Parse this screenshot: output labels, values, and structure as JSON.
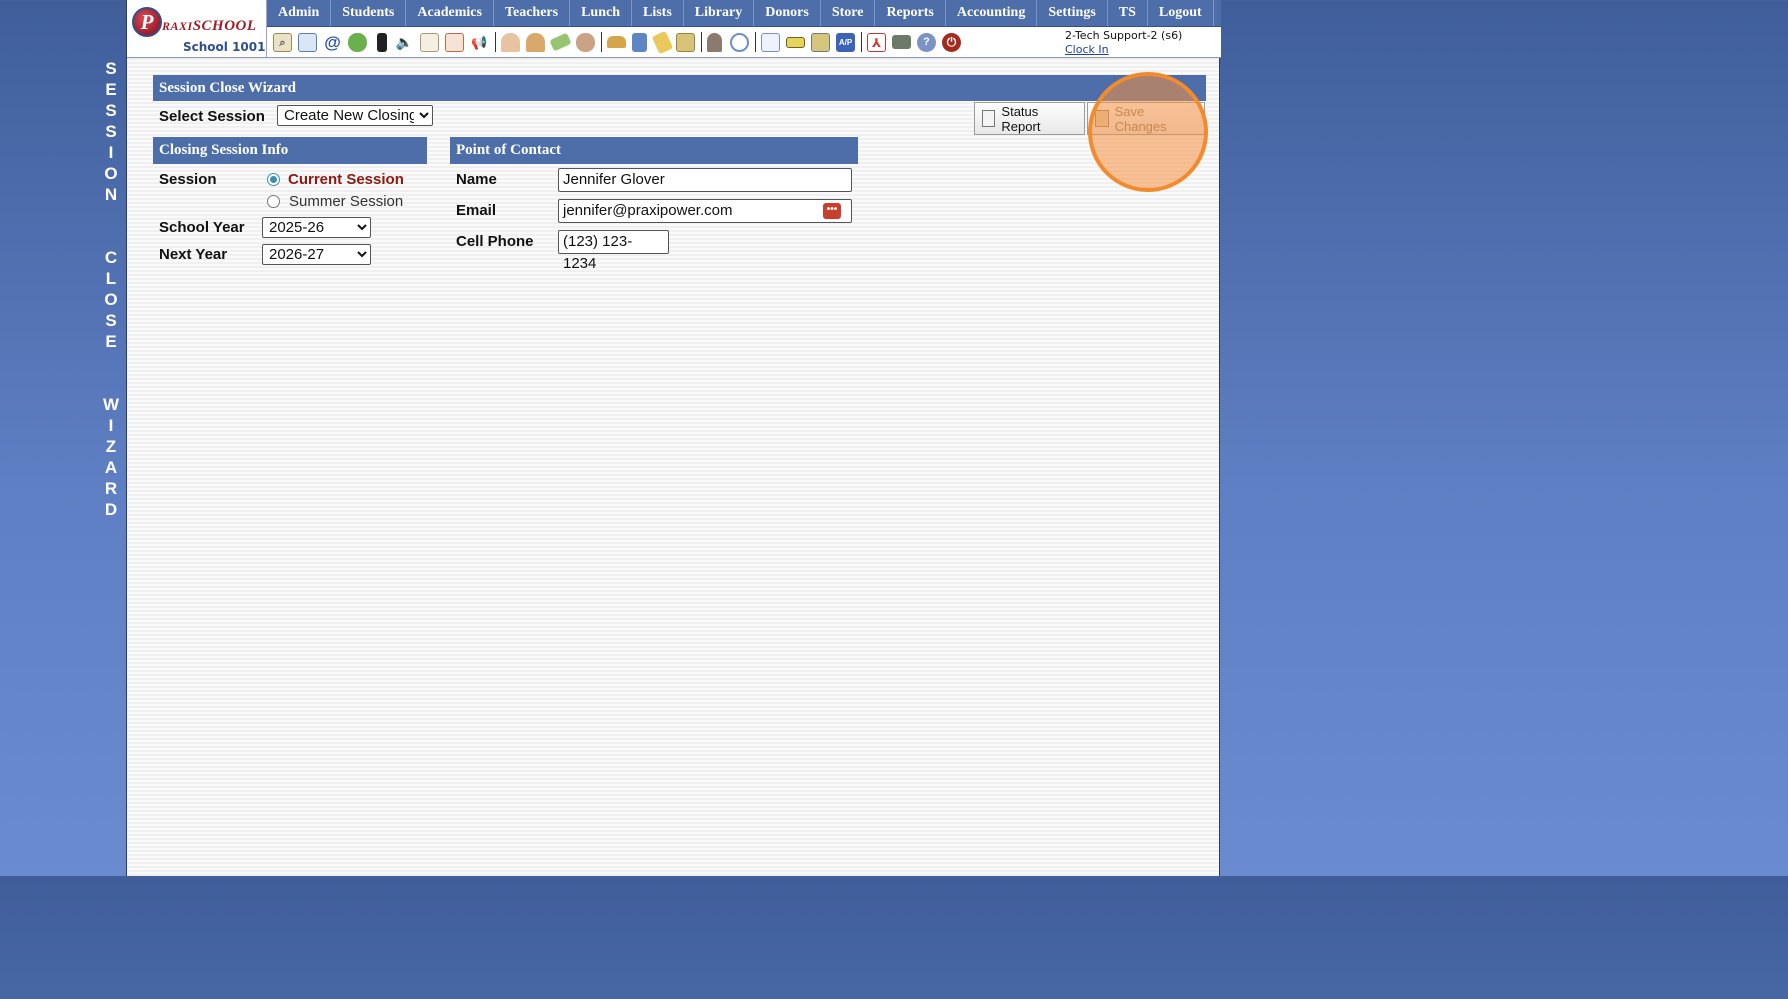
{
  "side_title": "SESSION  CLOSE  WIZARD",
  "logo": {
    "mark": "P",
    "name_prefix": "RAXI",
    "name_main": "SCHOOL",
    "school": "School 1001"
  },
  "nav": [
    "Admin",
    "Students",
    "Academics",
    "Teachers",
    "Lunch",
    "Lists",
    "Library",
    "Donors",
    "Store",
    "Reports",
    "Accounting",
    "Settings",
    "TS",
    "Logout"
  ],
  "user": {
    "name": "2-Tech Support-2 (s6)",
    "clock_in": "Clock In"
  },
  "wizard": {
    "title": "Session Close Wizard",
    "select_session_label": "Select Session",
    "select_session_value": "Create New Closing",
    "status_report": "Status Report",
    "save_changes": "Save Changes"
  },
  "closing": {
    "title": "Closing Session Info",
    "session_label": "Session",
    "current_session": "Current Session",
    "summer_session": "Summer Session",
    "school_year_label": "School Year",
    "school_year_value": "2025-26",
    "next_year_label": "Next Year",
    "next_year_value": "2026-27"
  },
  "contact": {
    "title": "Point of Contact",
    "name_label": "Name",
    "name_value": "Jennifer Glover",
    "email_label": "Email",
    "email_value": "jennifer@praxipower.com",
    "cell_label": "Cell Phone",
    "cell_value": "(123) 123-1234"
  },
  "colors": {
    "header_blue": "#4d6ea9",
    "accent_red": "#8b1a12",
    "highlight": "#f28a2e"
  }
}
